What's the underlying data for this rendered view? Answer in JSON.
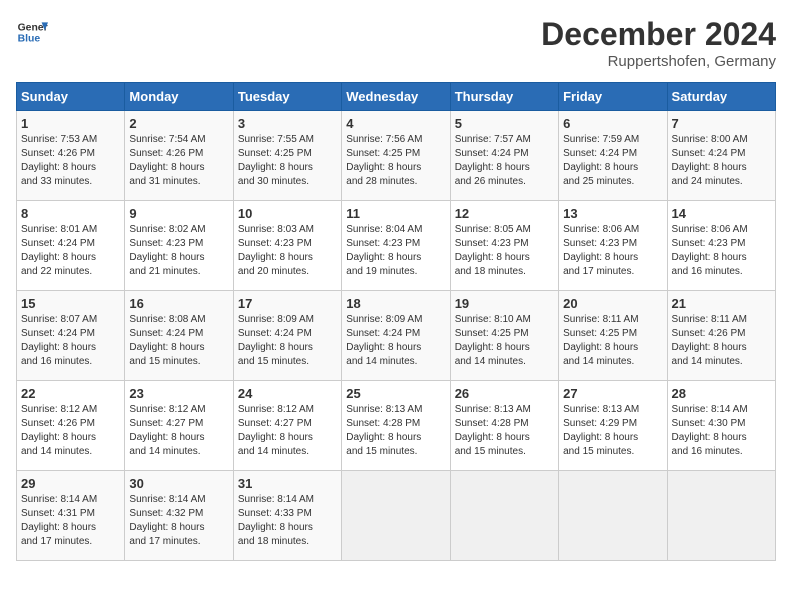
{
  "header": {
    "logo_line1": "General",
    "logo_line2": "Blue",
    "month": "December 2024",
    "location": "Ruppertshofen, Germany"
  },
  "weekdays": [
    "Sunday",
    "Monday",
    "Tuesday",
    "Wednesday",
    "Thursday",
    "Friday",
    "Saturday"
  ],
  "weeks": [
    [
      {
        "day": "1",
        "info": "Sunrise: 7:53 AM\nSunset: 4:26 PM\nDaylight: 8 hours\nand 33 minutes."
      },
      {
        "day": "2",
        "info": "Sunrise: 7:54 AM\nSunset: 4:26 PM\nDaylight: 8 hours\nand 31 minutes."
      },
      {
        "day": "3",
        "info": "Sunrise: 7:55 AM\nSunset: 4:25 PM\nDaylight: 8 hours\nand 30 minutes."
      },
      {
        "day": "4",
        "info": "Sunrise: 7:56 AM\nSunset: 4:25 PM\nDaylight: 8 hours\nand 28 minutes."
      },
      {
        "day": "5",
        "info": "Sunrise: 7:57 AM\nSunset: 4:24 PM\nDaylight: 8 hours\nand 26 minutes."
      },
      {
        "day": "6",
        "info": "Sunrise: 7:59 AM\nSunset: 4:24 PM\nDaylight: 8 hours\nand 25 minutes."
      },
      {
        "day": "7",
        "info": "Sunrise: 8:00 AM\nSunset: 4:24 PM\nDaylight: 8 hours\nand 24 minutes."
      }
    ],
    [
      {
        "day": "8",
        "info": "Sunrise: 8:01 AM\nSunset: 4:24 PM\nDaylight: 8 hours\nand 22 minutes."
      },
      {
        "day": "9",
        "info": "Sunrise: 8:02 AM\nSunset: 4:23 PM\nDaylight: 8 hours\nand 21 minutes."
      },
      {
        "day": "10",
        "info": "Sunrise: 8:03 AM\nSunset: 4:23 PM\nDaylight: 8 hours\nand 20 minutes."
      },
      {
        "day": "11",
        "info": "Sunrise: 8:04 AM\nSunset: 4:23 PM\nDaylight: 8 hours\nand 19 minutes."
      },
      {
        "day": "12",
        "info": "Sunrise: 8:05 AM\nSunset: 4:23 PM\nDaylight: 8 hours\nand 18 minutes."
      },
      {
        "day": "13",
        "info": "Sunrise: 8:06 AM\nSunset: 4:23 PM\nDaylight: 8 hours\nand 17 minutes."
      },
      {
        "day": "14",
        "info": "Sunrise: 8:06 AM\nSunset: 4:23 PM\nDaylight: 8 hours\nand 16 minutes."
      }
    ],
    [
      {
        "day": "15",
        "info": "Sunrise: 8:07 AM\nSunset: 4:24 PM\nDaylight: 8 hours\nand 16 minutes."
      },
      {
        "day": "16",
        "info": "Sunrise: 8:08 AM\nSunset: 4:24 PM\nDaylight: 8 hours\nand 15 minutes."
      },
      {
        "day": "17",
        "info": "Sunrise: 8:09 AM\nSunset: 4:24 PM\nDaylight: 8 hours\nand 15 minutes."
      },
      {
        "day": "18",
        "info": "Sunrise: 8:09 AM\nSunset: 4:24 PM\nDaylight: 8 hours\nand 14 minutes."
      },
      {
        "day": "19",
        "info": "Sunrise: 8:10 AM\nSunset: 4:25 PM\nDaylight: 8 hours\nand 14 minutes."
      },
      {
        "day": "20",
        "info": "Sunrise: 8:11 AM\nSunset: 4:25 PM\nDaylight: 8 hours\nand 14 minutes."
      },
      {
        "day": "21",
        "info": "Sunrise: 8:11 AM\nSunset: 4:26 PM\nDaylight: 8 hours\nand 14 minutes."
      }
    ],
    [
      {
        "day": "22",
        "info": "Sunrise: 8:12 AM\nSunset: 4:26 PM\nDaylight: 8 hours\nand 14 minutes."
      },
      {
        "day": "23",
        "info": "Sunrise: 8:12 AM\nSunset: 4:27 PM\nDaylight: 8 hours\nand 14 minutes."
      },
      {
        "day": "24",
        "info": "Sunrise: 8:12 AM\nSunset: 4:27 PM\nDaylight: 8 hours\nand 14 minutes."
      },
      {
        "day": "25",
        "info": "Sunrise: 8:13 AM\nSunset: 4:28 PM\nDaylight: 8 hours\nand 15 minutes."
      },
      {
        "day": "26",
        "info": "Sunrise: 8:13 AM\nSunset: 4:28 PM\nDaylight: 8 hours\nand 15 minutes."
      },
      {
        "day": "27",
        "info": "Sunrise: 8:13 AM\nSunset: 4:29 PM\nDaylight: 8 hours\nand 15 minutes."
      },
      {
        "day": "28",
        "info": "Sunrise: 8:14 AM\nSunset: 4:30 PM\nDaylight: 8 hours\nand 16 minutes."
      }
    ],
    [
      {
        "day": "29",
        "info": "Sunrise: 8:14 AM\nSunset: 4:31 PM\nDaylight: 8 hours\nand 17 minutes."
      },
      {
        "day": "30",
        "info": "Sunrise: 8:14 AM\nSunset: 4:32 PM\nDaylight: 8 hours\nand 17 minutes."
      },
      {
        "day": "31",
        "info": "Sunrise: 8:14 AM\nSunset: 4:33 PM\nDaylight: 8 hours\nand 18 minutes."
      },
      {
        "day": "",
        "info": ""
      },
      {
        "day": "",
        "info": ""
      },
      {
        "day": "",
        "info": ""
      },
      {
        "day": "",
        "info": ""
      }
    ]
  ]
}
